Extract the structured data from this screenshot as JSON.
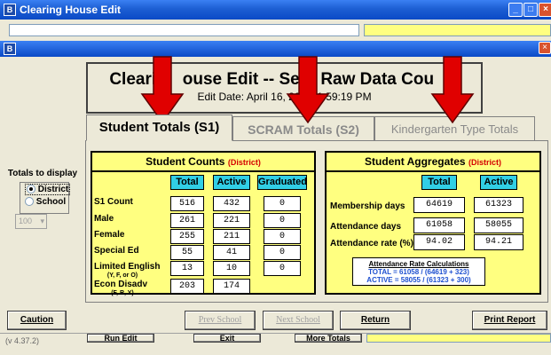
{
  "window": {
    "title": "Clearing House Edit",
    "icon": "app-icon"
  },
  "inner_window": {
    "icon": "app-icon"
  },
  "banner": {
    "title_parts": [
      "Clearin",
      "ouse Edit -- Se",
      "t Raw Data Cou",
      "s"
    ],
    "subtitle_parts": [
      "Edit Date:  April 16, 20",
      "01:59:19 PM"
    ]
  },
  "tabs": [
    {
      "label": "Student Totals (S1)",
      "active": true
    },
    {
      "label": "SCRAM Totals (S2)",
      "active": false
    },
    {
      "label": "Kindergarten Type Totals",
      "active": false
    }
  ],
  "totals_to_display": {
    "label": "Totals to display",
    "options": [
      {
        "label": "District",
        "selected": true
      },
      {
        "label": "School",
        "selected": false
      }
    ],
    "school_select": "100"
  },
  "student_counts": {
    "title": "Student Counts",
    "scope": "(District)",
    "columns": [
      "Total",
      "Active",
      "Graduated"
    ],
    "rows": [
      {
        "label": "S1 Count",
        "sub": "",
        "values": [
          "516",
          "432",
          "0"
        ]
      },
      {
        "label": "Male",
        "sub": "",
        "values": [
          "261",
          "221",
          "0"
        ]
      },
      {
        "label": "Female",
        "sub": "",
        "values": [
          "255",
          "211",
          "0"
        ]
      },
      {
        "label": "Special Ed",
        "sub": "",
        "values": [
          "55",
          "41",
          "0"
        ]
      },
      {
        "label": "Limited English",
        "sub": "(Y, F, or O)",
        "values": [
          "13",
          "10",
          "0"
        ]
      },
      {
        "label": "Econ Disadv",
        "sub": "(F, R, Y)",
        "values": [
          "203",
          "174",
          ""
        ]
      }
    ]
  },
  "student_aggregates": {
    "title": "Student Aggregates",
    "scope": "(District)",
    "columns": [
      "Total",
      "Active"
    ],
    "rows": [
      {
        "label": "Membership days",
        "values": [
          "64619",
          "61323"
        ]
      },
      {
        "label": "Attendance days",
        "values": [
          "61058",
          "58055"
        ]
      },
      {
        "label": "Attendance rate (%)",
        "values": [
          "94.02",
          "94.21"
        ]
      }
    ],
    "calc": {
      "title": "Attendance Rate Calculations",
      "lines": [
        "TOTAL  =  61058 / (64619 + 323)",
        "ACTIVE =  58055 / (61323 + 300)"
      ]
    }
  },
  "buttons": {
    "caution": "Caution",
    "prev_school": "Prev School",
    "next_school": "Next School",
    "return": "Return",
    "print_report": "Print Report"
  },
  "behind": {
    "version": "(v 4.37.2)",
    "btn1": "Run Edit",
    "btn2": "Exit",
    "btn3": "More Totals"
  },
  "colors": {
    "panel": "#ffff80",
    "header": "#31cfe6",
    "scope": "#d40000",
    "annotation_arrow": "#e00000"
  }
}
